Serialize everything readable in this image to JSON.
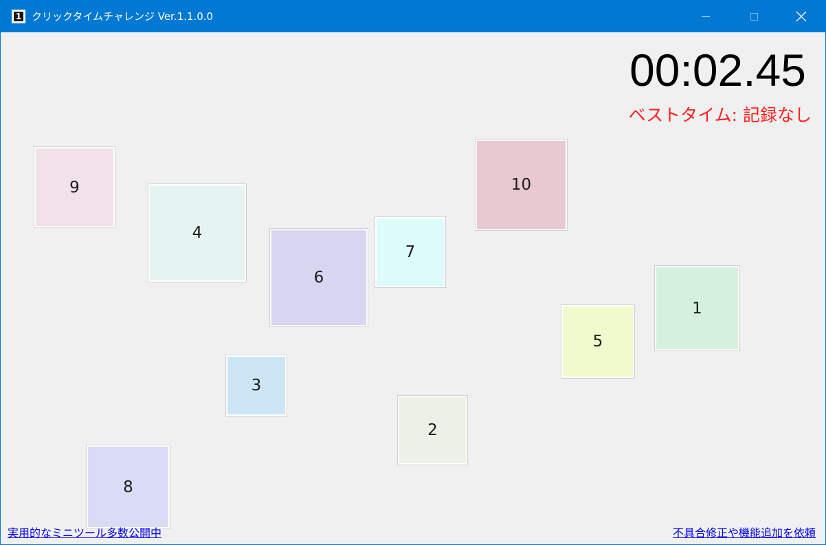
{
  "window": {
    "title": "クリックタイムチャレンジ Ver.1.1.0.0",
    "icon_label": "1",
    "accent_color": "#0078d4"
  },
  "timer": {
    "elapsed": "00:02.45",
    "best_time": "ベストタイム: 記録なし",
    "best_time_color": "#ff2020"
  },
  "tiles": [
    {
      "label": "9",
      "color": "#f1e2ea"
    },
    {
      "label": "4",
      "color": "#e6f4f1"
    },
    {
      "label": "6",
      "color": "#d8d6f0"
    },
    {
      "label": "7",
      "color": "#dcfbfa"
    },
    {
      "label": "10",
      "color": "#e8c8d1"
    },
    {
      "label": "1",
      "color": "#d5f0dc"
    },
    {
      "label": "5",
      "color": "#effacd"
    },
    {
      "label": "3",
      "color": "#cce6f6"
    },
    {
      "label": "2",
      "color": "#edf0e6"
    },
    {
      "label": "8",
      "color": "#dadcf6"
    }
  ],
  "footer": {
    "left_link": "実用的なミニツール多数公開中",
    "right_link": "不具合修正や機能追加を依頼"
  }
}
